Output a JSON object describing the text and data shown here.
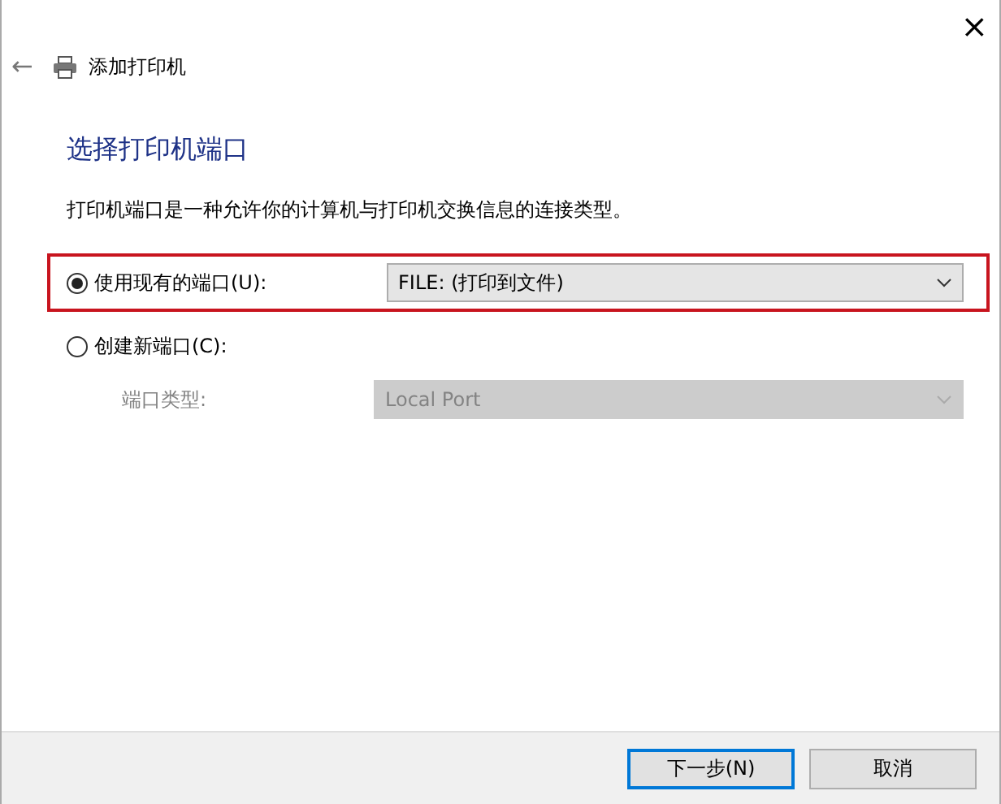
{
  "window": {
    "close": "×"
  },
  "header": {
    "back": "←",
    "title": "添加打印机"
  },
  "heading": "选择打印机端口",
  "description": "打印机端口是一种允许你的计算机与打印机交换信息的连接类型。",
  "options": [
    {
      "label": "使用现有的端口(U):",
      "selected": true,
      "highlighted": true,
      "value": "FILE: (打印到文件)",
      "disabled": false
    },
    {
      "label": "创建新端口(C):",
      "selected": false,
      "highlighted": false,
      "field_label": "端口类型:",
      "value": "Local Port",
      "disabled": true
    }
  ],
  "buttons": [
    {
      "label": "下一步(N)",
      "default": true
    },
    {
      "label": "取消",
      "default": false
    }
  ]
}
